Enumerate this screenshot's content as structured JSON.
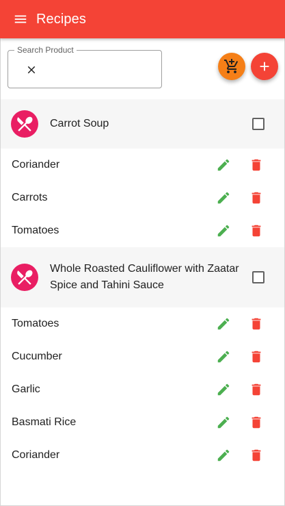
{
  "app": {
    "title": "Recipes"
  },
  "search": {
    "label": "Search Product",
    "value": ""
  },
  "colors": {
    "primary": "#f44336",
    "cart_fab": "#f57f17",
    "avatar": "#e91e63",
    "edit": "#4caf50",
    "delete": "#f44336"
  },
  "icons": {
    "menu": "menu-icon",
    "clear": "close-icon",
    "cart": "add-shopping-cart-icon",
    "add": "add-icon",
    "recipe": "restaurant-icon",
    "edit": "pencil-icon",
    "delete": "trash-icon"
  },
  "recipes": [
    {
      "name": "Carrot Soup",
      "checked": false,
      "ingredients": [
        {
          "name": "Coriander"
        },
        {
          "name": "Carrots"
        },
        {
          "name": "Tomatoes"
        }
      ]
    },
    {
      "name": "Whole Roasted Cauliflower with Zaatar Spice and Tahini Sauce",
      "checked": false,
      "ingredients": [
        {
          "name": "Tomatoes"
        },
        {
          "name": "Cucumber"
        },
        {
          "name": "Garlic"
        },
        {
          "name": "Basmati Rice"
        },
        {
          "name": "Coriander"
        }
      ]
    }
  ]
}
